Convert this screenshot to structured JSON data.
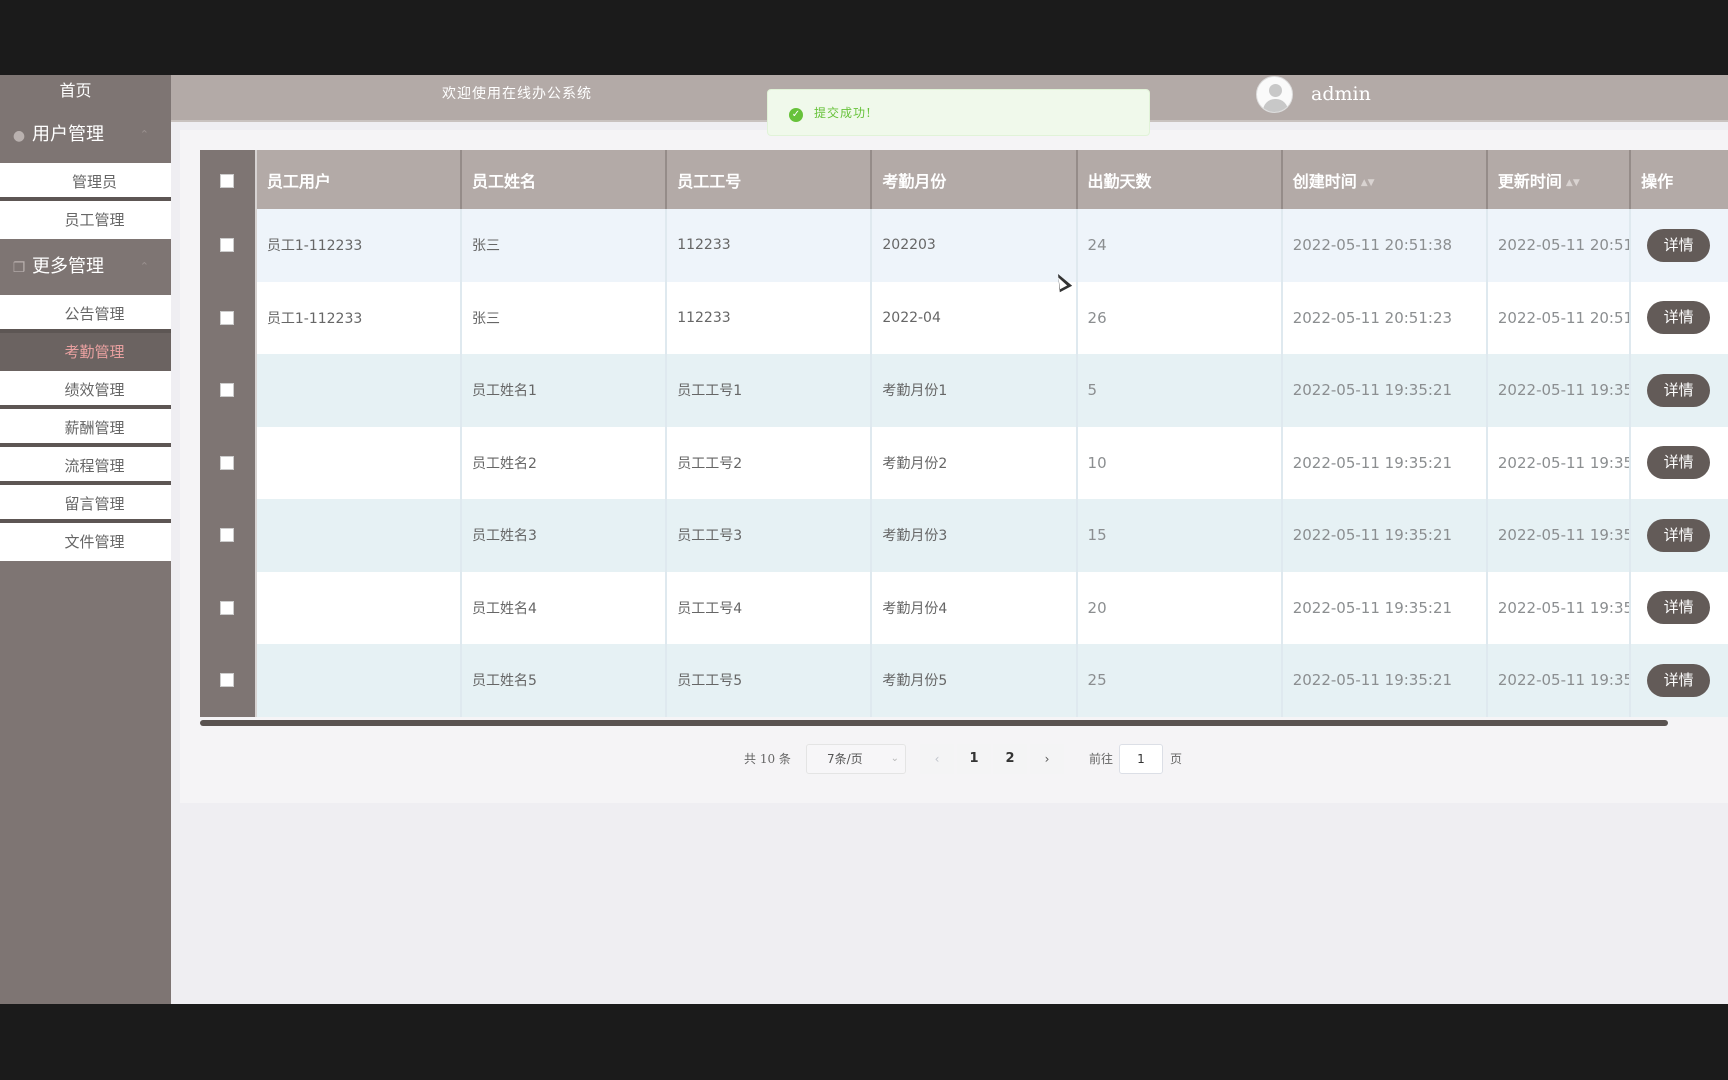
{
  "header": {
    "title": "欢迎使用在线办公系统",
    "username": "admin"
  },
  "toast": {
    "message": "提交成功!"
  },
  "sidebar": {
    "home": "首页",
    "groups": [
      {
        "label": "用户管理",
        "icon": "user-icon",
        "items": [
          "管理员",
          "员工管理"
        ]
      },
      {
        "label": "更多管理",
        "icon": "copy-icon",
        "items": [
          "公告管理",
          "考勤管理",
          "绩效管理",
          "薪酬管理",
          "流程管理",
          "留言管理",
          "文件管理"
        ]
      }
    ],
    "active_item": "考勤管理"
  },
  "table": {
    "columns": [
      "员工用户",
      "员工姓名",
      "员工工号",
      "考勤月份",
      "出勤天数",
      "创建时间",
      "更新时间",
      "操作"
    ],
    "rows": [
      {
        "user": "员工1-112233",
        "name": "张三",
        "no": "112233",
        "month": "202203",
        "days": "24",
        "created": "2022-05-11 20:51:38",
        "updated": "2022-05-11 20:51",
        "action": "详情"
      },
      {
        "user": "员工1-112233",
        "name": "张三",
        "no": "112233",
        "month": "2022-04",
        "days": "26",
        "created": "2022-05-11 20:51:23",
        "updated": "2022-05-11 20:51",
        "action": "详情"
      },
      {
        "user": "",
        "name": "员工姓名1",
        "no": "员工工号1",
        "month": "考勤月份1",
        "days": "5",
        "created": "2022-05-11 19:35:21",
        "updated": "2022-05-11 19:35",
        "action": "详情"
      },
      {
        "user": "",
        "name": "员工姓名2",
        "no": "员工工号2",
        "month": "考勤月份2",
        "days": "10",
        "created": "2022-05-11 19:35:21",
        "updated": "2022-05-11 19:35",
        "action": "详情"
      },
      {
        "user": "",
        "name": "员工姓名3",
        "no": "员工工号3",
        "month": "考勤月份3",
        "days": "15",
        "created": "2022-05-11 19:35:21",
        "updated": "2022-05-11 19:35",
        "action": "详情"
      },
      {
        "user": "",
        "name": "员工姓名4",
        "no": "员工工号4",
        "month": "考勤月份4",
        "days": "20",
        "created": "2022-05-11 19:35:21",
        "updated": "2022-05-11 19:35",
        "action": "详情"
      },
      {
        "user": "",
        "name": "员工姓名5",
        "no": "员工工号5",
        "month": "考勤月份5",
        "days": "25",
        "created": "2022-05-11 19:35:21",
        "updated": "2022-05-11 19:35",
        "action": "详情"
      }
    ]
  },
  "pagination": {
    "total": "共 10 条",
    "page_size": "7条/页",
    "pages": [
      "1",
      "2"
    ],
    "current_page": "1",
    "goto_label": "前往",
    "goto_value": "1",
    "page_suffix": "页"
  },
  "colors": {
    "sidebar_bg": "#7e7573",
    "header_bg": "#b3aaa7",
    "button_bg": "#635b58",
    "active_text": "#e8a0a0",
    "success": "#67c23a"
  }
}
